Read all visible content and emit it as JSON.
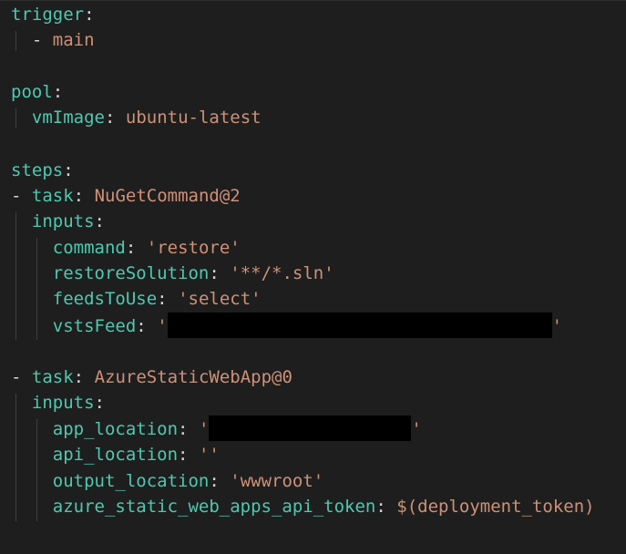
{
  "trigger": {
    "key": "trigger",
    "colon": ":",
    "dash": "-",
    "item": "main"
  },
  "pool": {
    "key": "pool",
    "colon": ":",
    "vmimage_key": "vmImage",
    "vmimage_value": "ubuntu-latest"
  },
  "steps": {
    "key": "steps",
    "colon": ":",
    "task1": {
      "dash": "-",
      "task_key": "task",
      "task_value": "NuGetCommand@2",
      "inputs_key": "inputs",
      "command_key": "command",
      "command_value": "'restore'",
      "restore_key": "restoreSolution",
      "restore_value": "'**/*.sln'",
      "feeds_key": "feedsToUse",
      "feeds_value": "'select'",
      "vsts_key": "vstsFeed",
      "vsts_open": "'",
      "vsts_close": "'"
    },
    "task2": {
      "dash": "-",
      "task_key": "task",
      "task_value": "AzureStaticWebApp@0",
      "inputs_key": "inputs",
      "app_key": "app_location",
      "app_open": "'",
      "app_close": "'",
      "api_key": "api_location",
      "api_value": "''",
      "output_key": "output_location",
      "output_value": "'wwwroot'",
      "token_key": "azure_static_web_apps_api_token",
      "token_value": "$(deployment_token)"
    }
  },
  "colors": {
    "background": "#1e1e1e",
    "key": "#4ec9b0",
    "string": "#ce9178",
    "text": "#d4d4d4",
    "redaction": "#000000"
  }
}
